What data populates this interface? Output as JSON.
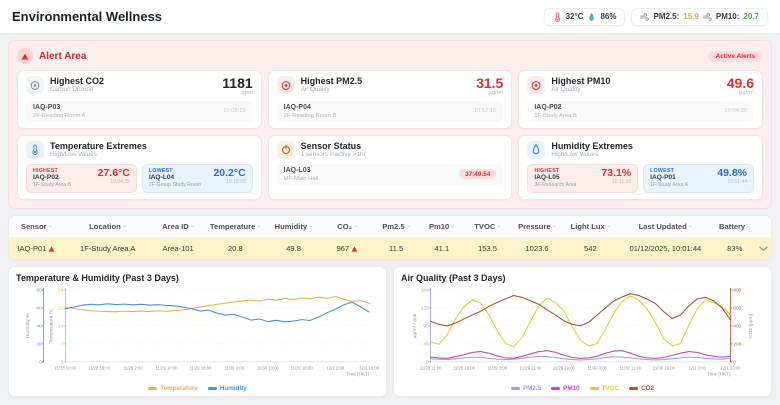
{
  "header": {
    "title": "Environmental Wellness",
    "temp": "32°C",
    "humidity": "86%",
    "pm25_label": "PM2.5:",
    "pm25_value": "15.9",
    "pm10_label": "PM10:",
    "pm10_value": "20.7"
  },
  "alert": {
    "title": "Alert Area",
    "badge": "Active Alerts",
    "cards": [
      {
        "title": "Highest CO2",
        "subtitle": "Carbon Dioxide",
        "value": "1181",
        "unit": "ppm",
        "sensor": "IAQ-P03",
        "location": "2F-Reading Room A",
        "time": "10:08:19"
      },
      {
        "title": "Highest PM2.5",
        "subtitle": "Air Quality",
        "value": "31.5",
        "unit": "µg/m³",
        "sensor": "IAQ-P04",
        "location": "2F-Reading Room B",
        "time": "10:12:16"
      },
      {
        "title": "Highest PM10",
        "subtitle": "Air Quality",
        "value": "49.6",
        "unit": "µg/m³",
        "sensor": "IAQ-P02",
        "location": "1F-Study Area B",
        "time": "10:04:39"
      }
    ],
    "temperature_extremes": {
      "title": "Temperature Extremes",
      "subtitle": "High/Low Values",
      "highest": {
        "label": "HIGHEST",
        "sensor": "IAQ-P02",
        "location": "1F-Study Area B",
        "value": "27.6°C",
        "time": "10:04:39"
      },
      "lowest": {
        "label": "LOWEST",
        "sensor": "IAQ-L04",
        "location": "2F-Group Study Room",
        "value": "20.2°C",
        "time": "10:18:03"
      }
    },
    "sensor_status": {
      "title": "Sensor Status",
      "subtitle": "1 sensors inactive >1hr",
      "sensor": "IAQ-L03",
      "location": "MF-Main Hall",
      "duration": "37:49:54"
    },
    "humidity_extremes": {
      "title": "Humidity Extremes",
      "subtitle": "High/Low Values",
      "highest": {
        "label": "HIGHEST",
        "sensor": "IAQ-L05",
        "location": "3F-Research Area",
        "value": "73.1%",
        "time": "10:11:10"
      },
      "lowest": {
        "label": "LOWEST",
        "sensor": "IAQ-P01",
        "location": "1F-Study Area A",
        "value": "49.8%",
        "time": "10:01:44"
      }
    }
  },
  "table": {
    "sort_indicator": "–",
    "columns": [
      "Sensor",
      "Location",
      "Area ID",
      "Temperature",
      "Humidity",
      "CO₂",
      "Pm2.5",
      "Pm10",
      "TVOC",
      "Pressure",
      "Light Lux",
      "Last Updated",
      "Battery"
    ],
    "row": {
      "sensor": "IAQ-P01",
      "location": "1F-Study Area A",
      "area_id": "Area-101",
      "temperature": "20.8",
      "humidity": "49.8",
      "co2": "967",
      "pm25": "11.5",
      "pm10": "41.1",
      "tvoc": "153.5",
      "pressure": "1023.6",
      "light_lux": "542",
      "last_updated": "01/12/2025, 10:01:44",
      "battery": "83%"
    }
  },
  "chart_data": [
    {
      "type": "line",
      "title": "Temperature & Humidity (Past 3 Days)",
      "x_label": "Time (HKT)",
      "x_ticks": [
        "11/28 10:00",
        "11/28 18:00",
        "11/29 2:00",
        "11/29 10:00",
        "11/29 18:00",
        "11/30 2:00",
        "11/30 10:00",
        "11/30 18:00",
        "12/1 2:00",
        "12/1 10:00"
      ],
      "grid": "dotted",
      "legend_position": "bottom",
      "axes": [
        {
          "id": "humidity",
          "label": "Humidity %",
          "color": "#4a8fe8",
          "max": 80,
          "ticks": [
            0,
            20,
            40,
            60,
            80
          ],
          "position": "left-outer"
        },
        {
          "id": "temperature",
          "label": "Temperature °C",
          "color": "#f3a95c",
          "max": 28,
          "ticks": [
            0,
            7,
            14,
            21,
            28
          ],
          "position": "left-inner"
        }
      ],
      "series": [
        {
          "name": "Temperature",
          "axis": "temperature",
          "color": "#f3a95c",
          "values": [
            21.2,
            20.8,
            20.3,
            19.9,
            19.7,
            19.6,
            19.5,
            19.7,
            19.6,
            19.8,
            19.6,
            19.9,
            19.7,
            20.0,
            20.3,
            20.8,
            21.3,
            21.9,
            22.4,
            22.9,
            23.3,
            23.8,
            24.1,
            23.7,
            24.4,
            24.0,
            24.7,
            24.2,
            24.9,
            24.5,
            25.2,
            24.7,
            25.5,
            24.3,
            23.5,
            23.9,
            22.7
          ]
        },
        {
          "name": "Humidity",
          "axis": "humidity",
          "color": "#4a8fe8",
          "values": [
            59,
            61,
            63,
            64,
            63.5,
            64.5,
            63.8,
            64.2,
            63.4,
            64.0,
            63.2,
            63.6,
            62.8,
            62.2,
            61.0,
            59.0,
            56.5,
            57.5,
            54.0,
            52.0,
            52.8,
            50.0,
            46.5,
            47.8,
            44.8,
            46.2,
            44.6,
            45.4,
            47.0,
            46.0,
            50.0,
            54.5,
            58.5,
            63.5,
            66.5,
            61.0,
            55.5
          ]
        }
      ]
    },
    {
      "type": "line",
      "title": "Air Quality (Past 3 Days)",
      "x_label": "Time (HKT)",
      "x_ticks": [
        "11/28 11:00",
        "11/28 19:00",
        "11/29 3:00",
        "11/29 11:00",
        "11/29 19:00",
        "11/30 3:00",
        "11/30 11:00",
        "11/30 19:00",
        "12/1 3:00",
        "12/1 10:00"
      ],
      "grid": "dotted",
      "legend_position": "bottom",
      "axes": [
        {
          "id": "pm",
          "label": "µg/m³ / ppb",
          "color": "#9a9ad8",
          "max": 180,
          "ticks": [
            0,
            45,
            90,
            135,
            180
          ],
          "position": "left-outer"
        },
        {
          "id": "co2",
          "label": "CO2 (ppm)",
          "color": "#b2502e",
          "max": 800,
          "ticks": [
            0,
            200,
            400,
            600,
            800
          ],
          "position": "right"
        }
      ],
      "series": [
        {
          "name": "PM2.5",
          "axis": "pm",
          "color": "#9aa0ee",
          "values": [
            8,
            7,
            6,
            8,
            10,
            12,
            11,
            9,
            7,
            6,
            7,
            9,
            12,
            14,
            13,
            11,
            8,
            6,
            5,
            6,
            8,
            11,
            13,
            12,
            10,
            8,
            6,
            5,
            6,
            8,
            10,
            12,
            11,
            9,
            8,
            7,
            9
          ]
        },
        {
          "name": "PM10",
          "axis": "pm",
          "color": "#bf44c6",
          "values": [
            12,
            10,
            9,
            13,
            18,
            24,
            26,
            22,
            15,
            10,
            9,
            14,
            20,
            26,
            28,
            24,
            17,
            11,
            9,
            10,
            14,
            22,
            27,
            28,
            22,
            14,
            10,
            9,
            11,
            16,
            22,
            26,
            24,
            18,
            14,
            12,
            14
          ]
        },
        {
          "name": "TVOC",
          "axis": "pm",
          "color": "#f0c239",
          "values": [
            50,
            44,
            68,
            108,
            138,
            155,
            148,
            118,
            78,
            46,
            38,
            62,
            102,
            140,
            160,
            148,
            128,
            88,
            54,
            40,
            46,
            82,
            122,
            152,
            165,
            154,
            132,
            98,
            58,
            40,
            46,
            92,
            132,
            155,
            148,
            138,
            118
          ]
        },
        {
          "name": "CO2",
          "axis": "co2",
          "color": "#b2502e",
          "values": [
            450,
            418,
            400,
            432,
            478,
            522,
            562,
            618,
            662,
            702,
            738,
            718,
            678,
            640,
            578,
            520,
            458,
            418,
            402,
            442,
            522,
            602,
            678,
            722,
            758,
            738,
            698,
            648,
            558,
            482,
            522,
            622,
            698,
            718,
            678,
            598,
            468
          ]
        }
      ]
    }
  ]
}
